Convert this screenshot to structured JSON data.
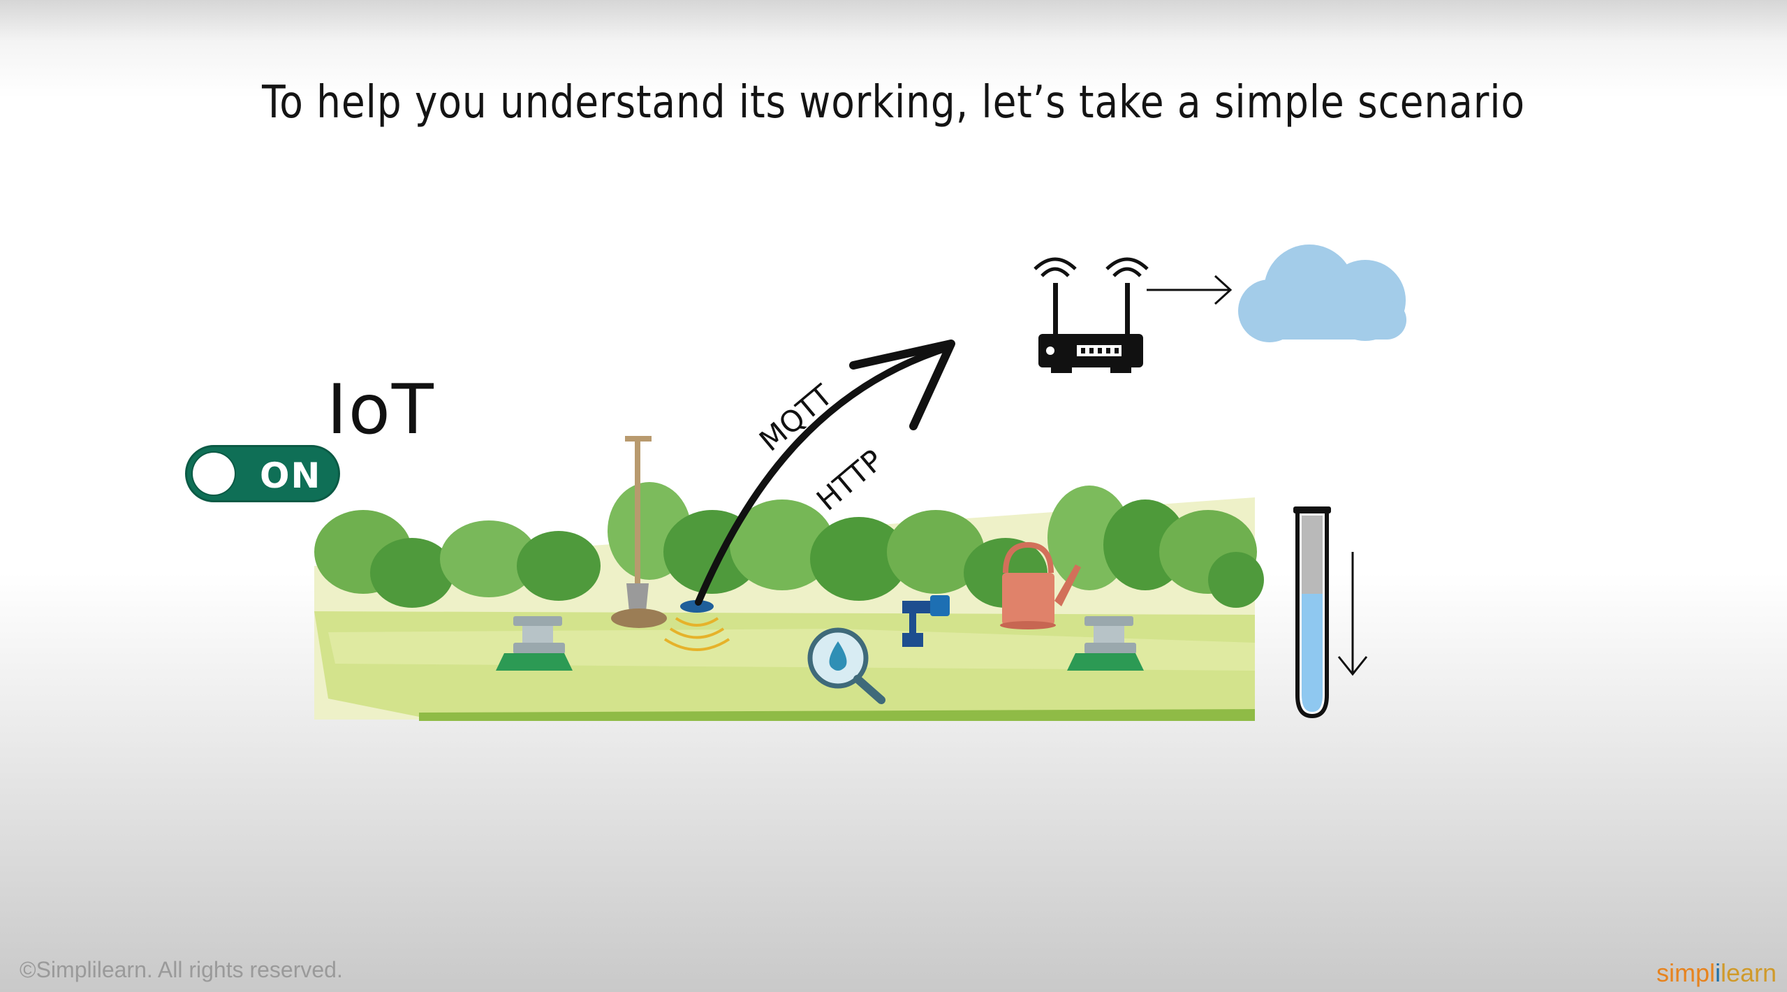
{
  "slide": {
    "title": "To help you understand its working, let’s take a simple scenario",
    "iot_label": "IoT",
    "toggle_label": "ON",
    "protocols": [
      "MQTT",
      "HTTP"
    ],
    "copyright": "©Simplilearn. All rights reserved.",
    "brand": {
      "part1": "simpl",
      "part2": "i",
      "part3": "learn"
    }
  },
  "icons": {
    "toggle": "toggle-switch-icon",
    "router": "wifi-router-icon",
    "cloud": "cloud-icon",
    "arrow_right": "arrow-right-icon",
    "test_tube": "test-tube-icon",
    "arrow_down": "arrow-down-icon",
    "moisture_sensor": "soil-moisture-sensor-icon",
    "magnifier": "water-magnifier-icon",
    "sprinkler": "sprinkler-icon",
    "valve": "water-valve-icon",
    "watering_can": "watering-can-icon",
    "shovel": "shovel-icon"
  },
  "colors": {
    "toggle_green": "#0f6f56",
    "cloud_blue": "#a3cce9",
    "water_blue": "#8fc8f0",
    "grass_light": "#cfe08a",
    "bush_green": "#4e9a3a"
  }
}
